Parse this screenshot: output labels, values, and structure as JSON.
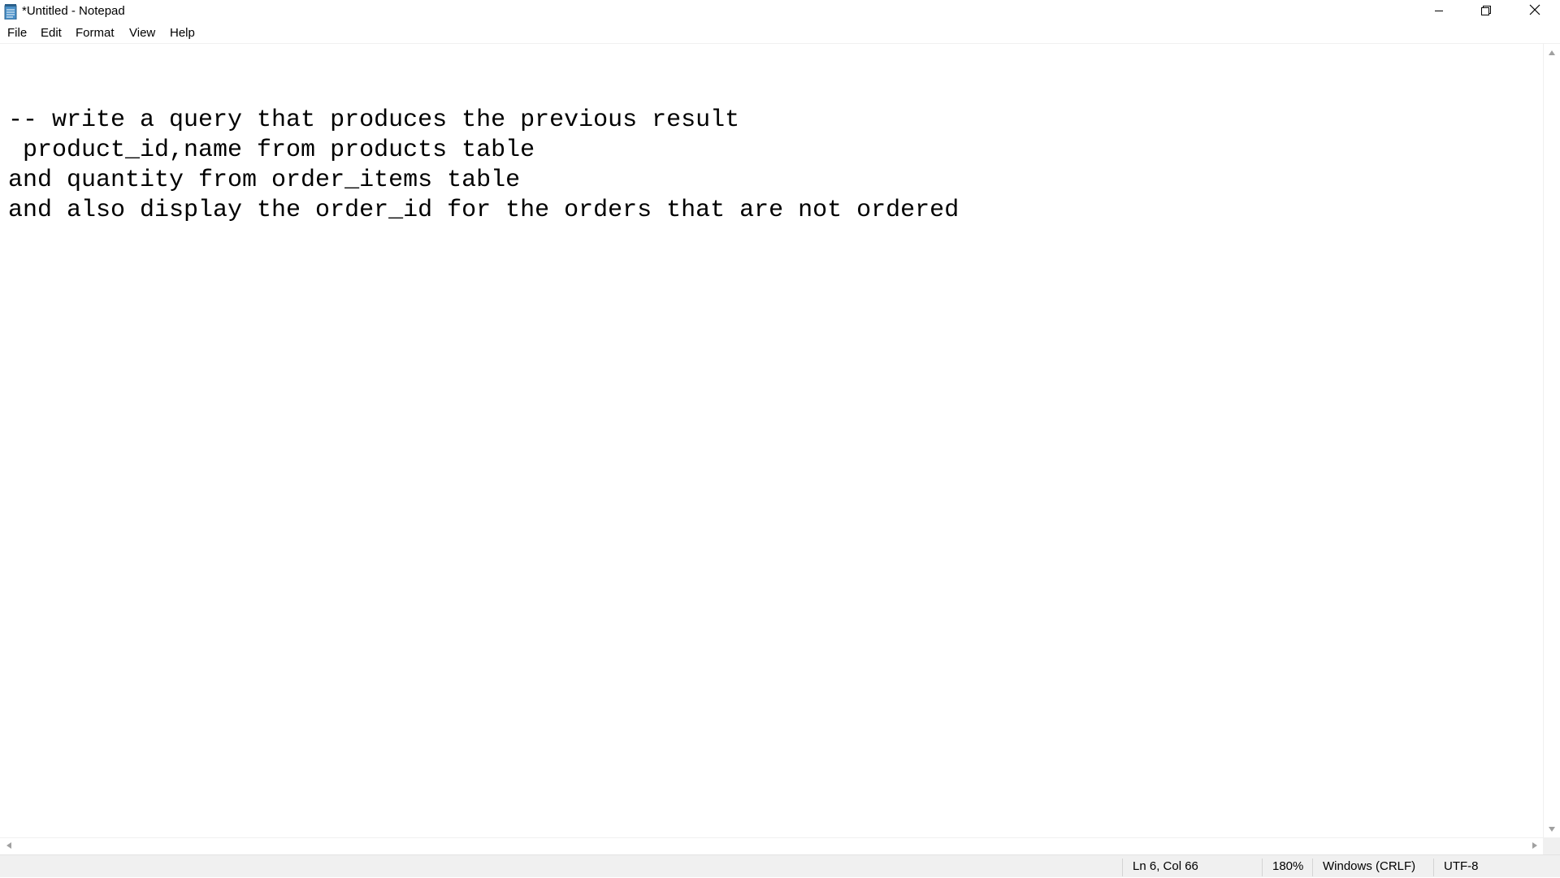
{
  "window": {
    "title": "*Untitled - Notepad",
    "icon": "notepad-icon"
  },
  "caption_buttons": {
    "minimize_icon": "minimize-icon",
    "restore_icon": "restore-icon",
    "close_icon": "close-icon"
  },
  "menu": {
    "items": [
      {
        "label": "File"
      },
      {
        "label": "Edit"
      },
      {
        "label": "Format"
      },
      {
        "label": "View"
      },
      {
        "label": "Help"
      }
    ]
  },
  "editor": {
    "content": "-- write a query that produces the previous result\n product_id,name from products table\nand quantity from order_items table\nand also display the order_id for the orders that are not ordered"
  },
  "status_bar": {
    "position": "Ln 6, Col 66",
    "zoom": "180%",
    "line_ending": "Windows (CRLF)",
    "encoding": "UTF-8"
  },
  "colors": {
    "background": "#ffffff",
    "status_bar": "#f0f0f0",
    "text": "#000000"
  }
}
